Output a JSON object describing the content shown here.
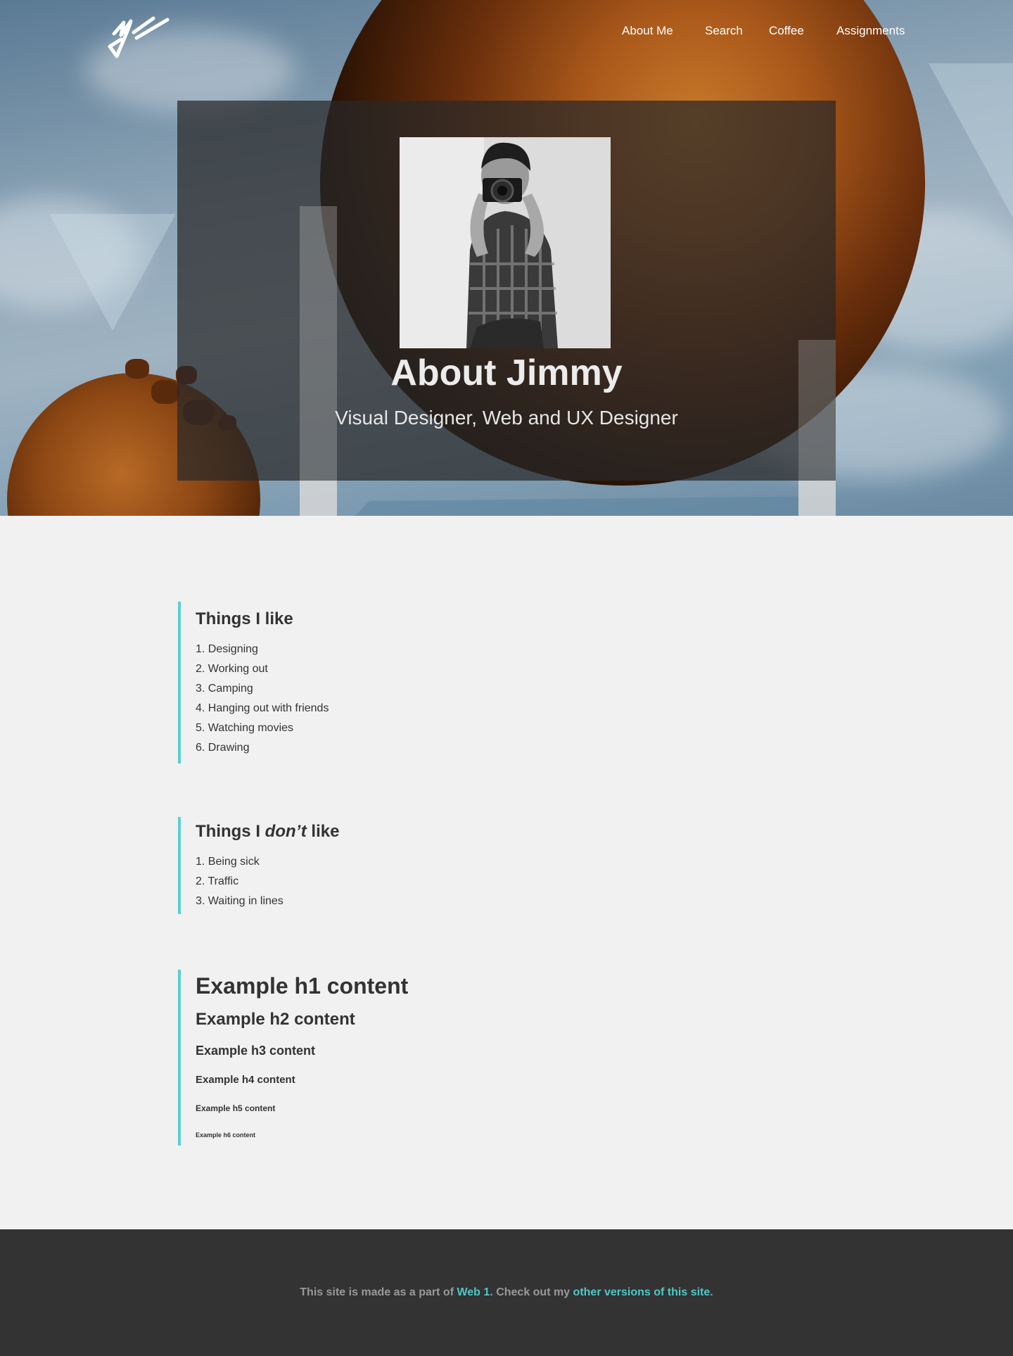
{
  "nav": {
    "items": [
      {
        "label": "About Me"
      },
      {
        "label": "Search"
      },
      {
        "label": "Coffee"
      },
      {
        "label": "Assignments"
      }
    ]
  },
  "hero": {
    "title": "About Jimmy",
    "subtitle": "Visual Designer, Web and UX Designer"
  },
  "likes": {
    "heading": "Things I like",
    "items": [
      "1. Designing",
      "2. Working out",
      "3. Camping",
      "4. Hanging out with friends",
      "5. Watching movies",
      "6. Drawing"
    ]
  },
  "dislikes": {
    "heading_prefix": "Things I ",
    "heading_emphasis": "don’t",
    "heading_suffix": " like",
    "items": [
      "1. Being sick",
      "2. Traffic",
      "3. Waiting in lines"
    ]
  },
  "examples": {
    "h1": "Example h1 content",
    "h2": "Example h2 content",
    "h3": "Example h3 content",
    "h4": "Example h4 content",
    "h5": "Example h5 content",
    "h6": "Example h6 content"
  },
  "footer": {
    "text_1": "This site is made as a part of ",
    "link_1": "Web 1",
    "text_2": ". Check out my ",
    "link_2": "other versions of this site",
    "text_3": "."
  },
  "colors": {
    "accent": "#5bcfcf",
    "footer_bg": "#333333",
    "page_bg": "#f1f1f1"
  },
  "icons": {
    "logo": "jw-signature-logo"
  }
}
